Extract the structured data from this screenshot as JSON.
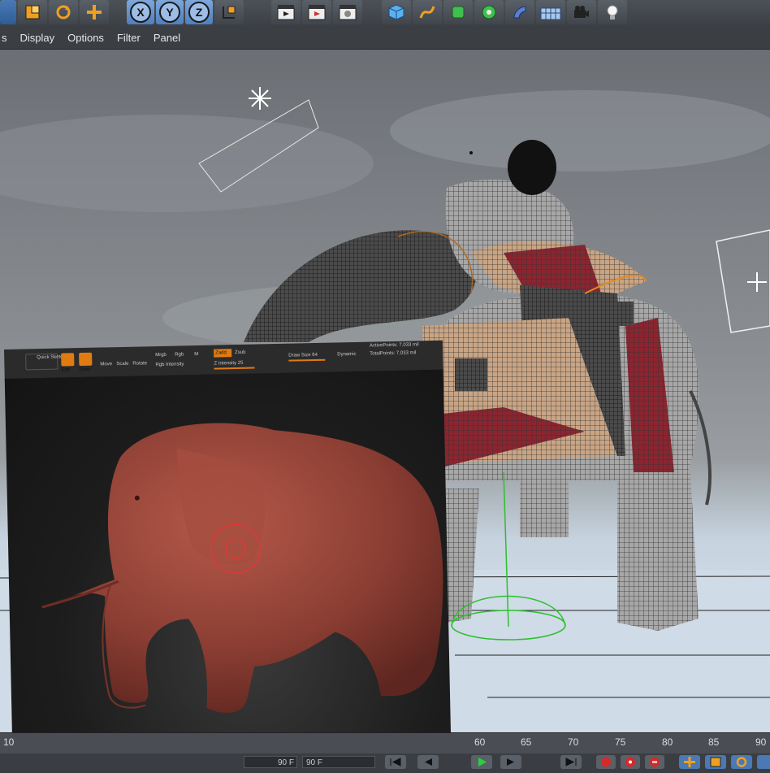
{
  "menu": {
    "items": [
      {
        "label": "s"
      },
      {
        "label": "Display"
      },
      {
        "label": "Options"
      },
      {
        "label": "Filter"
      },
      {
        "label": "Panel"
      }
    ]
  },
  "toolbar": {
    "axes": [
      "X",
      "Y",
      "Z"
    ],
    "icons": [
      "scale-icon",
      "rotate-icon",
      "move-icon",
      "coordinate-system-icon",
      "render-view-icon",
      "render-region-icon",
      "render-settings-icon",
      "cube-icon",
      "spline-icon",
      "nurbs-icon",
      "modeling-icon",
      "deformer-icon",
      "floor-icon",
      "camera-icon",
      "light-icon"
    ]
  },
  "zbrush": {
    "quick_sketch": "Quick Sketch",
    "edit": "Edit",
    "draw": "Draw",
    "move": "Move",
    "scale": "Scale",
    "rotate": "Rotate",
    "rgb": "Rgb",
    "mrgb": "Mrgb",
    "m": "M",
    "zadd": "Zadd",
    "zsub": "Zsub",
    "rgb_intensity": "Rgb Intensity",
    "z_intensity": "Z Intensity 25",
    "draw_size": "Draw Size 64",
    "dynamic": "Dynamic",
    "active_points": "ActivePoints: 7,033 mil",
    "total_points": "TotalPoints: 7,033 mil"
  },
  "timeline": {
    "ticks": [
      "10",
      "60",
      "65",
      "70",
      "75",
      "80",
      "85",
      "90"
    ],
    "field_left": "90 F",
    "field_right": "90 F"
  },
  "colors": {
    "accent_blue": "#5b8fd0",
    "zbrush_orange": "#e07b12",
    "clay": "#9a4a3e"
  }
}
